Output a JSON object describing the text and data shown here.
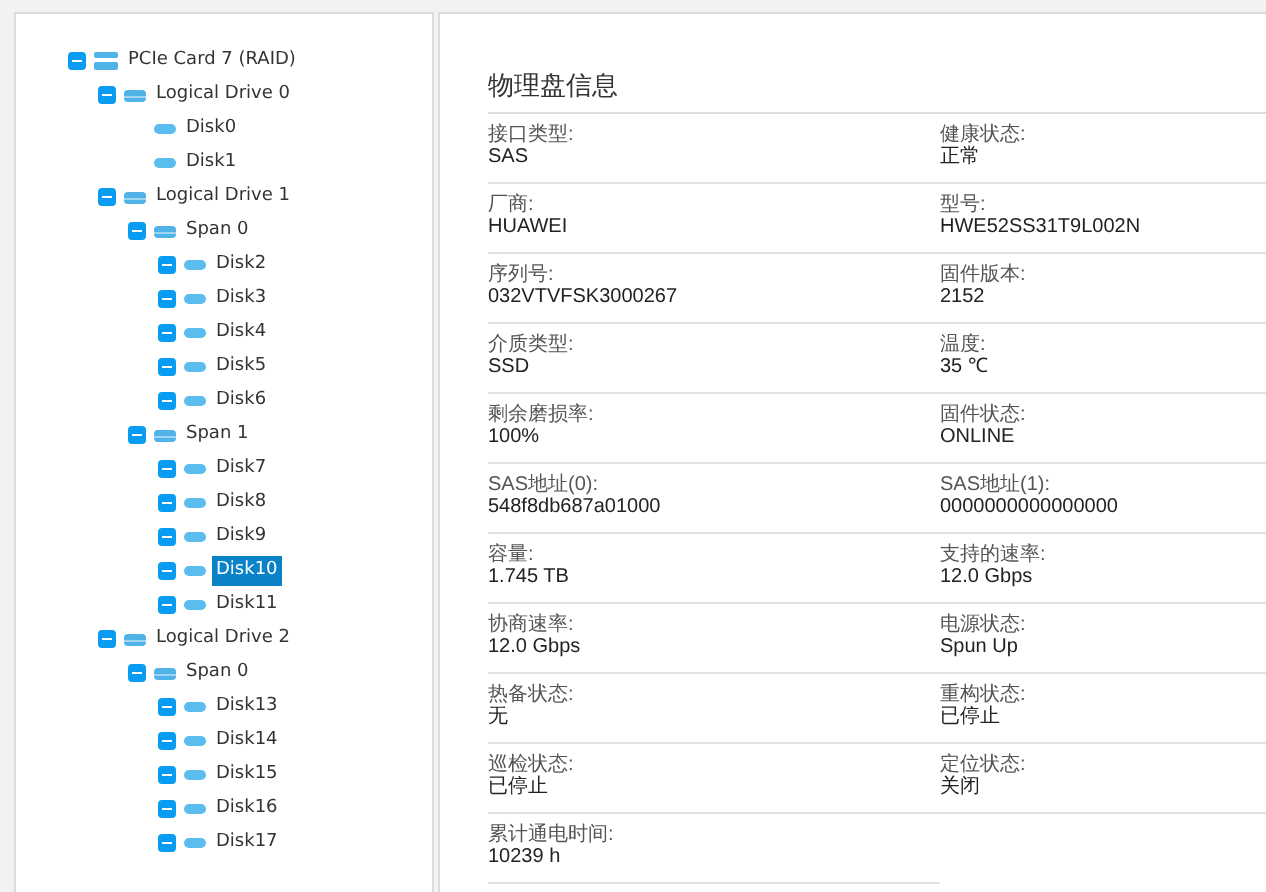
{
  "tree": [
    {
      "label": "PCIe Card 7 (RAID)",
      "kind": "card",
      "expanded": true,
      "selected": false,
      "children": [
        {
          "label": "Logical Drive 0",
          "kind": "drive",
          "expanded": true,
          "selected": false,
          "children": [
            {
              "label": "Disk0",
              "kind": "disk",
              "selected": false
            },
            {
              "label": "Disk1",
              "kind": "disk",
              "selected": false
            }
          ]
        },
        {
          "label": "Logical Drive 1",
          "kind": "drive",
          "expanded": true,
          "selected": false,
          "children": [
            {
              "label": "Span 0",
              "kind": "drive",
              "expanded": true,
              "selected": false,
              "children": [
                {
                  "label": "Disk2",
                  "kind": "disk",
                  "expanded": true,
                  "selected": false
                },
                {
                  "label": "Disk3",
                  "kind": "disk",
                  "expanded": true,
                  "selected": false
                },
                {
                  "label": "Disk4",
                  "kind": "disk",
                  "expanded": true,
                  "selected": false
                },
                {
                  "label": "Disk5",
                  "kind": "disk",
                  "expanded": true,
                  "selected": false
                },
                {
                  "label": "Disk6",
                  "kind": "disk",
                  "expanded": true,
                  "selected": false
                }
              ]
            },
            {
              "label": "Span 1",
              "kind": "drive",
              "expanded": true,
              "selected": false,
              "children": [
                {
                  "label": "Disk7",
                  "kind": "disk",
                  "expanded": true,
                  "selected": false
                },
                {
                  "label": "Disk8",
                  "kind": "disk",
                  "expanded": true,
                  "selected": false
                },
                {
                  "label": "Disk9",
                  "kind": "disk",
                  "expanded": true,
                  "selected": false
                },
                {
                  "label": "Disk10",
                  "kind": "disk",
                  "expanded": true,
                  "selected": true
                },
                {
                  "label": "Disk11",
                  "kind": "disk",
                  "expanded": true,
                  "selected": false
                }
              ]
            }
          ]
        },
        {
          "label": "Logical Drive 2",
          "kind": "drive",
          "expanded": true,
          "selected": false,
          "children": [
            {
              "label": "Span 0",
              "kind": "drive",
              "expanded": true,
              "selected": false,
              "children": [
                {
                  "label": "Disk13",
                  "kind": "disk",
                  "expanded": true,
                  "selected": false
                },
                {
                  "label": "Disk14",
                  "kind": "disk",
                  "expanded": true,
                  "selected": false
                },
                {
                  "label": "Disk15",
                  "kind": "disk",
                  "expanded": true,
                  "selected": false
                },
                {
                  "label": "Disk16",
                  "kind": "disk",
                  "expanded": true,
                  "selected": false
                },
                {
                  "label": "Disk17",
                  "kind": "disk",
                  "expanded": true,
                  "selected": false
                }
              ]
            }
          ]
        }
      ]
    }
  ],
  "details": {
    "title": "物理盘信息",
    "fields": [
      {
        "label": "接口类型:",
        "value": "SAS"
      },
      {
        "label": "健康状态:",
        "value": "正常"
      },
      {
        "label": "厂商:",
        "value": "HUAWEI"
      },
      {
        "label": "型号:",
        "value": "HWE52SS31T9L002N"
      },
      {
        "label": "序列号:",
        "value": "032VTVFSK3000267"
      },
      {
        "label": "固件版本:",
        "value": "2152"
      },
      {
        "label": "介质类型:",
        "value": "SSD"
      },
      {
        "label": "温度:",
        "value": "35 ℃"
      },
      {
        "label": "剩余磨损率:",
        "value": "100%"
      },
      {
        "label": "固件状态:",
        "value": "ONLINE"
      },
      {
        "label": "SAS地址(0):",
        "value": "548f8db687a01000"
      },
      {
        "label": "SAS地址(1):",
        "value": "0000000000000000"
      },
      {
        "label": "容量:",
        "value": "1.745 TB"
      },
      {
        "label": "支持的速率:",
        "value": "12.0 Gbps"
      },
      {
        "label": "协商速率:",
        "value": "12.0 Gbps"
      },
      {
        "label": "电源状态:",
        "value": "Spun Up"
      },
      {
        "label": "热备状态:",
        "value": "无"
      },
      {
        "label": "重构状态:",
        "value": "已停止"
      },
      {
        "label": "巡检状态:",
        "value": "已停止"
      },
      {
        "label": "定位状态:",
        "value": "关闭"
      },
      {
        "label": "累计通电时间:",
        "value": "10239 h"
      }
    ]
  }
}
